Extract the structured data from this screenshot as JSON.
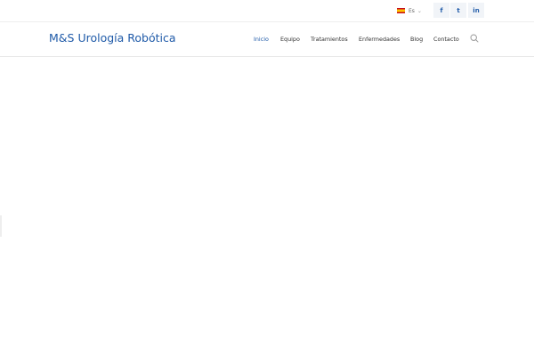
{
  "topbar": {
    "language": {
      "label": "Es",
      "flag": "spain-flag-icon"
    },
    "social": [
      {
        "name": "facebook",
        "glyph": "f"
      },
      {
        "name": "twitter",
        "glyph": "t"
      },
      {
        "name": "linkedin",
        "glyph": "in"
      }
    ]
  },
  "header": {
    "logo": "M&S Urología Robótica",
    "nav": [
      {
        "label": "Inicio",
        "active": true
      },
      {
        "label": "Equipo",
        "active": false
      },
      {
        "label": "Tratamientos",
        "active": false
      },
      {
        "label": "Enfermedades",
        "active": false
      },
      {
        "label": "Blog",
        "active": false
      },
      {
        "label": "Contacto",
        "active": false
      }
    ],
    "search_icon": "search-icon"
  },
  "colors": {
    "brand": "#1f5aa8",
    "nav_text": "#333333",
    "social_bg": "#f1f4f8"
  }
}
